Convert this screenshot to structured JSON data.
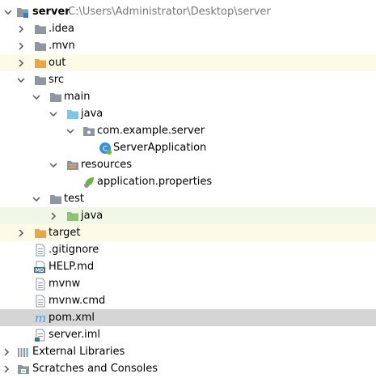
{
  "tree": {
    "root": {
      "label": "server",
      "path": "C:\\Users\\Administrator\\Desktop\\server"
    },
    "items": [
      {
        "label": ".idea"
      },
      {
        "label": ".mvn"
      },
      {
        "label": "out"
      },
      {
        "label": "src"
      },
      {
        "label": "main"
      },
      {
        "label": "java"
      },
      {
        "label": "com.example.server"
      },
      {
        "label": "ServerApplication"
      },
      {
        "label": "resources"
      },
      {
        "label": "application.properties"
      },
      {
        "label": "test"
      },
      {
        "label": "java"
      },
      {
        "label": "target"
      },
      {
        "label": ".gitignore"
      },
      {
        "label": "HELP.md"
      },
      {
        "label": "mvnw"
      },
      {
        "label": "mvnw.cmd"
      },
      {
        "label": "pom.xml"
      },
      {
        "label": "server.iml"
      },
      {
        "label": "External Libraries"
      },
      {
        "label": "Scratches and Consoles"
      }
    ]
  },
  "icons": {
    "md_badge": "MD",
    "class_badge": "C"
  },
  "colors": {
    "folder_gray": "#8f96a0",
    "folder_orange": "#e9a54a",
    "folder_blue": "#7ec6e7",
    "folder_green": "#8ec27a",
    "arrow": "#555555",
    "selection": "#d5d5d5",
    "excluded_bg": "#fbfbe8",
    "test_bg": "#f0f7e6"
  }
}
